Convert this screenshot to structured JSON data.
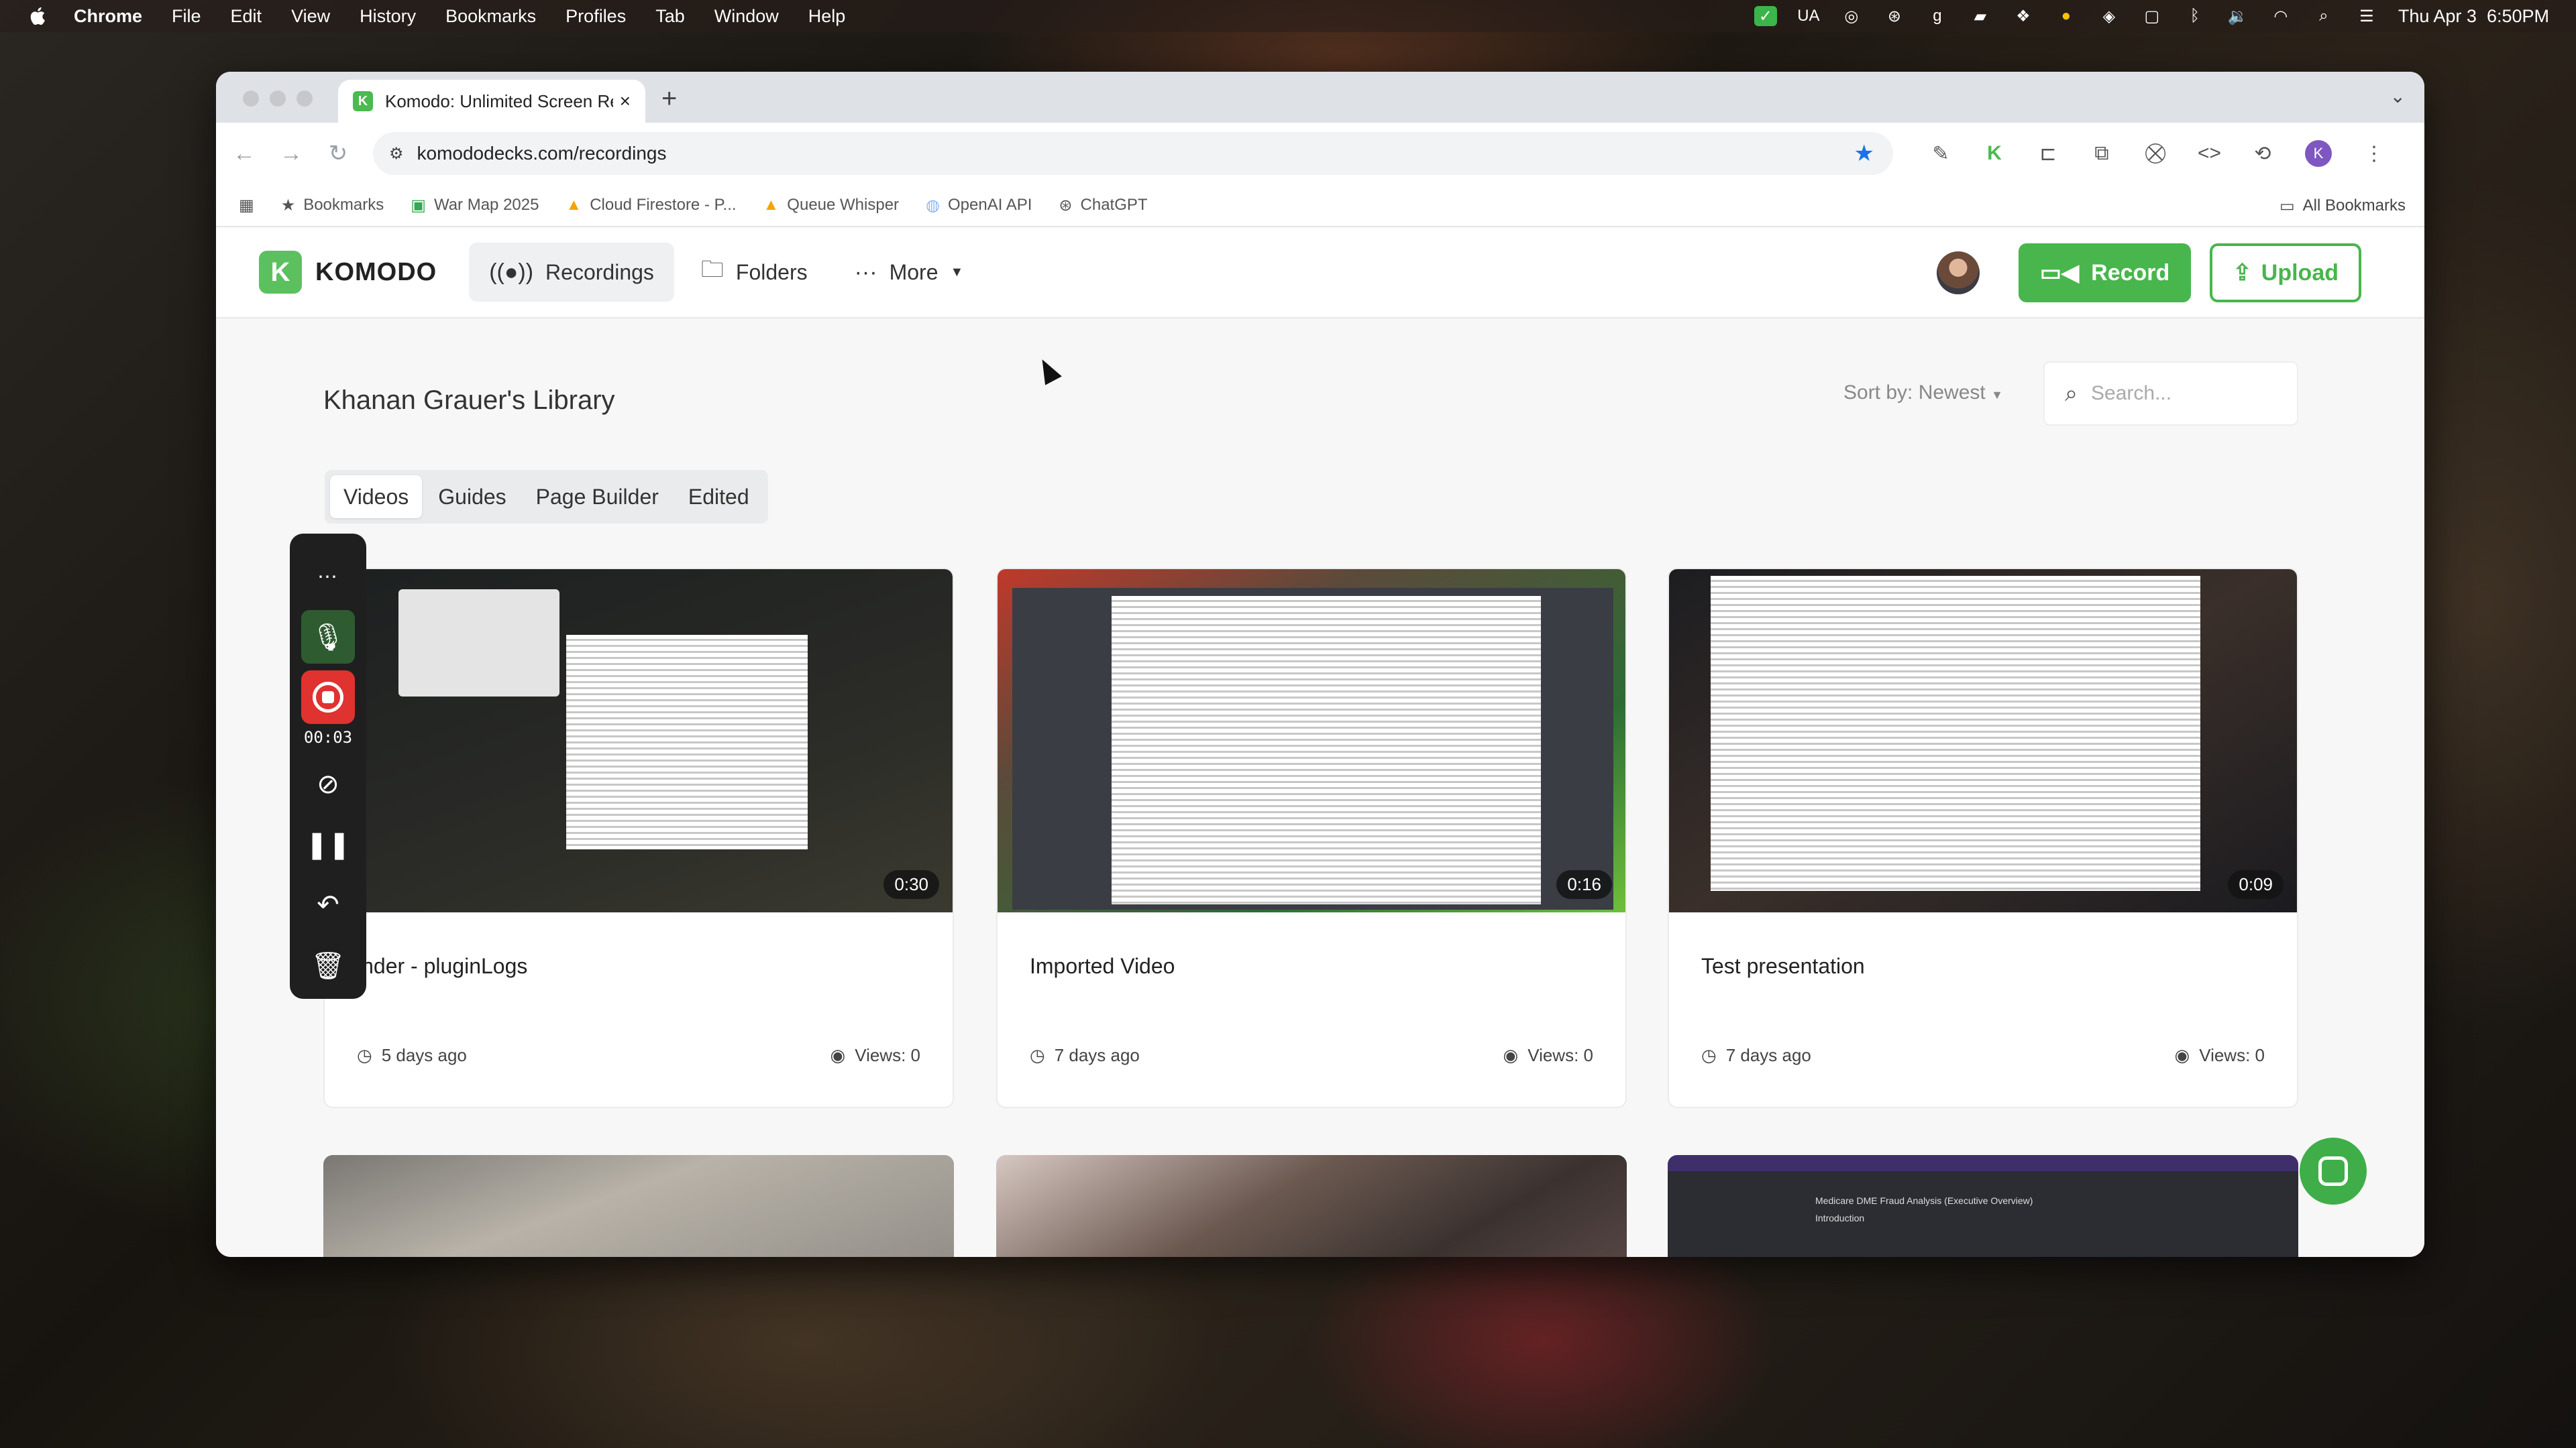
{
  "menubar": {
    "app": "Chrome",
    "items": [
      "File",
      "Edit",
      "View",
      "History",
      "Bookmarks",
      "Profiles",
      "Tab",
      "Window",
      "Help"
    ],
    "status_text": "UA",
    "datetime": "Thu Apr 3  6:50PM"
  },
  "browser": {
    "tab_title": "Komodo: Unlimited Screen Re",
    "url": "komododecks.com/recordings",
    "bookmarks": [
      "Bookmarks",
      "War Map 2025",
      "Cloud Firestore - P...",
      "Queue Whisper",
      "OpenAI API",
      "ChatGPT"
    ],
    "all_bookmarks": "All Bookmarks",
    "profile_initial": "K"
  },
  "app": {
    "logo_letter": "K",
    "logo_text": "KOMODO",
    "nav": {
      "recordings": "Recordings",
      "folders": "Folders",
      "more": "More"
    },
    "record_label": "Record",
    "upload_label": "Upload",
    "accent_color": "#48b64c"
  },
  "library": {
    "title": "Khanan Grauer's Library",
    "sort_label": "Sort by: Newest",
    "search_placeholder": "Search...",
    "tabs": [
      "Videos",
      "Guides",
      "Page Builder",
      "Edited"
    ],
    "active_tab": "Videos",
    "videos": [
      {
        "title": "inder - pluginLogs",
        "duration": "0:30",
        "age": "5 days ago",
        "views": "Views: 0"
      },
      {
        "title": "Imported Video",
        "duration": "0:16",
        "age": "7 days ago",
        "views": "Views: 0"
      },
      {
        "title": "Test presentation",
        "duration": "0:09",
        "age": "7 days ago",
        "views": "Views: 0"
      }
    ],
    "second_row_thumb_text": [
      "Medicare DME Fraud Analysis (Executive Overview)",
      "Introduction"
    ]
  },
  "recorder": {
    "timer": "00:03"
  }
}
